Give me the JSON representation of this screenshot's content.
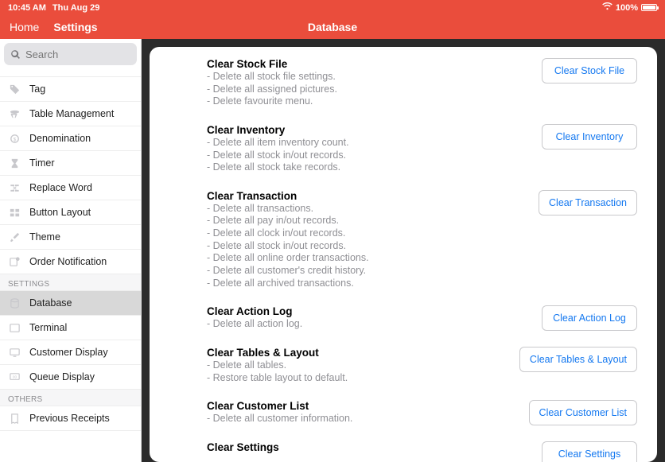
{
  "status": {
    "time": "10:45 AM",
    "date": "Thu Aug 29",
    "battery": "100%"
  },
  "nav": {
    "home": "Home",
    "settings": "Settings",
    "title": "Database"
  },
  "search": {
    "placeholder": "Search"
  },
  "sidebar": {
    "items1": [
      {
        "label": "Tag",
        "icon": "tag-icon"
      },
      {
        "label": "Table Management",
        "icon": "table-icon"
      },
      {
        "label": "Denomination",
        "icon": "coin-icon"
      },
      {
        "label": "Timer",
        "icon": "hourglass-icon"
      },
      {
        "label": "Replace Word",
        "icon": "replace-icon"
      },
      {
        "label": "Button Layout",
        "icon": "grid-icon"
      },
      {
        "label": "Theme",
        "icon": "brush-icon"
      },
      {
        "label": "Order Notification",
        "icon": "notification-icon"
      }
    ],
    "section_settings": "SETTINGS",
    "items2": [
      {
        "label": "Database",
        "icon": "database-icon"
      },
      {
        "label": "Terminal",
        "icon": "terminal-icon"
      },
      {
        "label": "Customer Display",
        "icon": "display-icon"
      },
      {
        "label": "Queue Display",
        "icon": "queue-icon"
      }
    ],
    "section_others": "OTHERS",
    "items3": [
      {
        "label": "Previous Receipts",
        "icon": "receipt-icon"
      }
    ]
  },
  "groups": [
    {
      "title": "Clear Stock File",
      "button": "Clear Stock File",
      "lines": [
        "- Delete all stock file settings.",
        "- Delete all assigned pictures.",
        "- Delete favourite menu."
      ]
    },
    {
      "title": "Clear Inventory",
      "button": "Clear Inventory",
      "lines": [
        "- Delete all item inventory count.",
        "- Delete all stock in/out records.",
        "- Delete all stock take records."
      ]
    },
    {
      "title": "Clear Transaction",
      "button": "Clear Transaction",
      "lines": [
        "- Delete all transactions.",
        "- Delete all pay in/out records.",
        "- Delete all clock in/out records.",
        "- Delete all stock in/out records.",
        "- Delete all online order transactions.",
        "- Delete all customer's credit history.",
        "- Delete all archived transactions."
      ]
    },
    {
      "title": "Clear Action Log",
      "button": "Clear Action Log",
      "lines": [
        "- Delete all action log."
      ]
    },
    {
      "title": "Clear Tables & Layout",
      "button": "Clear Tables & Layout",
      "lines": [
        "- Delete all tables.",
        "- Restore table layout to default."
      ]
    },
    {
      "title": "Clear Customer List",
      "button": "Clear Customer List",
      "lines": [
        "- Delete all customer information."
      ]
    },
    {
      "title": "Clear Settings",
      "button": "Clear Settings",
      "lines": []
    }
  ]
}
